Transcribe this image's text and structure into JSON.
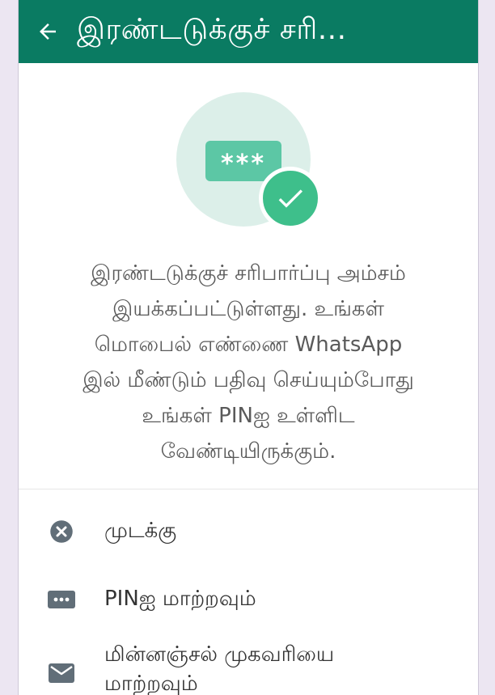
{
  "appbar": {
    "title": "இரண்டடுக்குச் சரி..."
  },
  "hero": {
    "pin_mask": "***"
  },
  "description": {
    "lines": [
      "இரண்டடுக்குச் சரிபார்ப்பு அம்சம்",
      "இயக்கப்பட்டுள்ளது. உங்கள்",
      "மொபைல் எண்ணை WhatsApp",
      "இல் மீண்டும் பதிவு செய்யும்போது",
      "உங்கள் PINஐ உள்ளிட",
      "வேண்டியிருக்கும்."
    ]
  },
  "menu": {
    "items": [
      {
        "label": "முடக்கு",
        "icon": "cancel-circle-icon"
      },
      {
        "label": "PINஐ மாற்றவும்",
        "icon": "dots-pin-icon"
      },
      {
        "label_line1": "மின்னஞ்சல் முகவரியை",
        "label_line2": "மாற்றவும்",
        "icon": "email-icon"
      }
    ]
  },
  "colors": {
    "appbar": "#0a7b62",
    "accent": "#3ebf8b",
    "pin_card": "#5cc7a5",
    "hero_circle": "#dcefe9"
  }
}
